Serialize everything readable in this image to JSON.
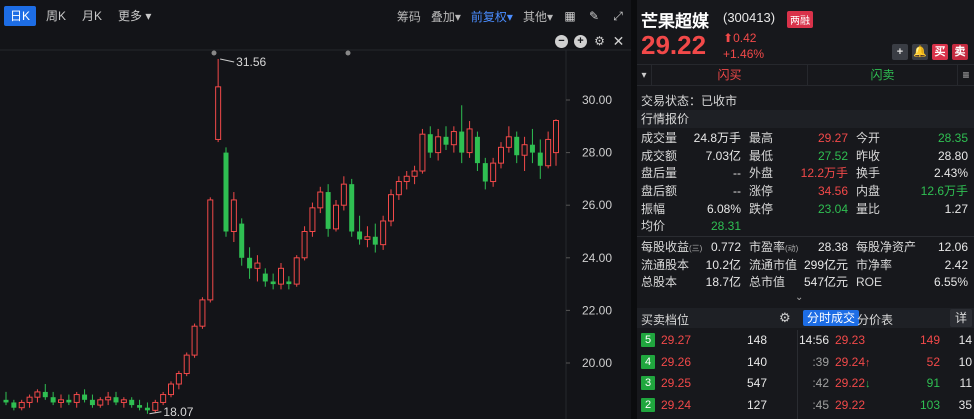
{
  "toolbar": {
    "tabs": [
      "日K",
      "周K",
      "月K",
      "更多"
    ],
    "right_items": [
      "筹码",
      "叠加",
      "前复权",
      "其他"
    ]
  },
  "chart_data": {
    "type": "candlestick",
    "y_ticks": [
      "30.00",
      "28.00",
      "26.00",
      "24.00",
      "22.00",
      "20.00"
    ],
    "ylim": [
      18.0,
      31.8
    ],
    "max_label": "31.56",
    "min_label": "18.07",
    "up_color": "#f24949",
    "down_color": "#2fbf52",
    "candles": [
      {
        "o": 18.6,
        "h": 18.9,
        "l": 18.4,
        "c": 18.5
      },
      {
        "o": 18.5,
        "h": 18.6,
        "l": 18.2,
        "c": 18.3
      },
      {
        "o": 18.3,
        "h": 18.6,
        "l": 18.2,
        "c": 18.5
      },
      {
        "o": 18.5,
        "h": 18.8,
        "l": 18.3,
        "c": 18.7
      },
      {
        "o": 18.7,
        "h": 19.0,
        "l": 18.5,
        "c": 18.9
      },
      {
        "o": 18.9,
        "h": 19.2,
        "l": 18.6,
        "c": 18.7
      },
      {
        "o": 18.7,
        "h": 18.9,
        "l": 18.4,
        "c": 18.5
      },
      {
        "o": 18.5,
        "h": 18.8,
        "l": 18.3,
        "c": 18.6
      },
      {
        "o": 18.6,
        "h": 18.8,
        "l": 18.4,
        "c": 18.5
      },
      {
        "o": 18.5,
        "h": 18.9,
        "l": 18.3,
        "c": 18.8
      },
      {
        "o": 18.8,
        "h": 19.0,
        "l": 18.5,
        "c": 18.6
      },
      {
        "o": 18.6,
        "h": 18.8,
        "l": 18.3,
        "c": 18.4
      },
      {
        "o": 18.4,
        "h": 18.7,
        "l": 18.3,
        "c": 18.6
      },
      {
        "o": 18.6,
        "h": 18.9,
        "l": 18.4,
        "c": 18.7
      },
      {
        "o": 18.7,
        "h": 18.9,
        "l": 18.4,
        "c": 18.5
      },
      {
        "o": 18.5,
        "h": 18.7,
        "l": 18.3,
        "c": 18.6
      },
      {
        "o": 18.6,
        "h": 18.7,
        "l": 18.3,
        "c": 18.4
      },
      {
        "o": 18.4,
        "h": 18.6,
        "l": 18.2,
        "c": 18.3
      },
      {
        "o": 18.3,
        "h": 18.5,
        "l": 18.07,
        "c": 18.2
      },
      {
        "o": 18.2,
        "h": 18.6,
        "l": 18.1,
        "c": 18.5
      },
      {
        "o": 18.5,
        "h": 18.9,
        "l": 18.4,
        "c": 18.8
      },
      {
        "o": 18.8,
        "h": 19.3,
        "l": 18.7,
        "c": 19.2
      },
      {
        "o": 19.2,
        "h": 19.7,
        "l": 19.0,
        "c": 19.6
      },
      {
        "o": 19.6,
        "h": 20.4,
        "l": 19.5,
        "c": 20.3
      },
      {
        "o": 20.3,
        "h": 21.5,
        "l": 20.2,
        "c": 21.4
      },
      {
        "o": 21.4,
        "h": 22.5,
        "l": 21.3,
        "c": 22.4
      },
      {
        "o": 22.4,
        "h": 26.3,
        "l": 22.3,
        "c": 26.2
      },
      {
        "o": 28.5,
        "h": 31.56,
        "l": 28.4,
        "c": 30.5
      },
      {
        "o": 28.0,
        "h": 28.2,
        "l": 24.8,
        "c": 25.0
      },
      {
        "o": 25.0,
        "h": 26.5,
        "l": 24.6,
        "c": 26.2
      },
      {
        "o": 25.3,
        "h": 25.5,
        "l": 23.7,
        "c": 24.0
      },
      {
        "o": 24.0,
        "h": 24.4,
        "l": 23.2,
        "c": 23.6
      },
      {
        "o": 23.6,
        "h": 24.1,
        "l": 23.1,
        "c": 23.8
      },
      {
        "o": 23.4,
        "h": 23.6,
        "l": 22.9,
        "c": 23.1
      },
      {
        "o": 23.1,
        "h": 23.4,
        "l": 22.8,
        "c": 23.0
      },
      {
        "o": 23.0,
        "h": 23.8,
        "l": 22.8,
        "c": 23.6
      },
      {
        "o": 23.1,
        "h": 23.3,
        "l": 22.8,
        "c": 23.0
      },
      {
        "o": 23.0,
        "h": 24.1,
        "l": 22.9,
        "c": 24.0
      },
      {
        "o": 24.0,
        "h": 25.2,
        "l": 23.9,
        "c": 25.0
      },
      {
        "o": 25.0,
        "h": 26.1,
        "l": 24.8,
        "c": 25.9
      },
      {
        "o": 25.9,
        "h": 26.7,
        "l": 25.7,
        "c": 26.5
      },
      {
        "o": 26.5,
        "h": 26.8,
        "l": 24.8,
        "c": 25.1
      },
      {
        "o": 25.1,
        "h": 26.2,
        "l": 25.0,
        "c": 26.0
      },
      {
        "o": 26.0,
        "h": 27.1,
        "l": 25.8,
        "c": 26.8
      },
      {
        "o": 26.8,
        "h": 27.0,
        "l": 24.8,
        "c": 25.0
      },
      {
        "o": 25.0,
        "h": 25.6,
        "l": 24.5,
        "c": 24.7
      },
      {
        "o": 24.7,
        "h": 25.2,
        "l": 24.4,
        "c": 24.8
      },
      {
        "o": 24.8,
        "h": 25.3,
        "l": 24.2,
        "c": 24.5
      },
      {
        "o": 24.5,
        "h": 25.6,
        "l": 24.3,
        "c": 25.4
      },
      {
        "o": 25.4,
        "h": 26.6,
        "l": 25.2,
        "c": 26.4
      },
      {
        "o": 26.4,
        "h": 27.1,
        "l": 26.2,
        "c": 26.9
      },
      {
        "o": 26.9,
        "h": 27.3,
        "l": 26.6,
        "c": 27.1
      },
      {
        "o": 27.1,
        "h": 27.5,
        "l": 26.8,
        "c": 27.3
      },
      {
        "o": 27.3,
        "h": 28.9,
        "l": 27.2,
        "c": 28.7
      },
      {
        "o": 28.7,
        "h": 29.0,
        "l": 27.8,
        "c": 28.0
      },
      {
        "o": 28.0,
        "h": 28.9,
        "l": 27.7,
        "c": 28.6
      },
      {
        "o": 28.6,
        "h": 29.0,
        "l": 28.1,
        "c": 28.3
      },
      {
        "o": 28.3,
        "h": 29.0,
        "l": 28.0,
        "c": 28.8
      },
      {
        "o": 28.8,
        "h": 29.8,
        "l": 27.6,
        "c": 28.0
      },
      {
        "o": 28.0,
        "h": 29.2,
        "l": 27.8,
        "c": 28.9
      },
      {
        "o": 28.6,
        "h": 28.8,
        "l": 27.3,
        "c": 27.6
      },
      {
        "o": 27.6,
        "h": 27.8,
        "l": 26.6,
        "c": 26.9
      },
      {
        "o": 26.9,
        "h": 27.8,
        "l": 26.7,
        "c": 27.6
      },
      {
        "o": 27.6,
        "h": 28.4,
        "l": 27.4,
        "c": 28.2
      },
      {
        "o": 28.2,
        "h": 29.0,
        "l": 28.0,
        "c": 28.6
      },
      {
        "o": 28.6,
        "h": 28.8,
        "l": 27.6,
        "c": 27.9
      },
      {
        "o": 27.9,
        "h": 28.6,
        "l": 27.3,
        "c": 28.3
      },
      {
        "o": 28.3,
        "h": 28.9,
        "l": 27.6,
        "c": 28.0
      },
      {
        "o": 28.0,
        "h": 28.5,
        "l": 27.0,
        "c": 27.5
      },
      {
        "o": 27.5,
        "h": 28.8,
        "l": 27.4,
        "c": 28.5
      },
      {
        "o": 28.0,
        "h": 29.27,
        "l": 27.5,
        "c": 29.22
      }
    ]
  },
  "stock": {
    "name": "芒果超媒",
    "code": "(300413)",
    "badge": "两融",
    "price": "29.22",
    "change": "0.42",
    "change_pct": "+1.46%"
  },
  "header_buttons": [
    "+",
    "●",
    "买",
    "卖"
  ],
  "trade": {
    "flash_buy": "闪买",
    "flash_sell": "闪卖",
    "sm": "▾",
    "menu": "≡"
  },
  "status_label": "交易状态：已收市",
  "quote_section_title": "行情报价",
  "quotes": [
    [
      [
        "成交量",
        "24.8万手",
        "white"
      ],
      [
        "最高",
        "29.27",
        "red"
      ],
      [
        "今开",
        "28.35",
        "green"
      ]
    ],
    [
      [
        "成交额",
        "7.03亿",
        "white"
      ],
      [
        "最低",
        "27.52",
        "green"
      ],
      [
        "昨收",
        "28.80",
        "white"
      ]
    ],
    [
      [
        "盘后量",
        "--",
        "white"
      ],
      [
        "外盘",
        "12.2万手",
        "red"
      ],
      [
        "换手",
        "2.43%",
        "white"
      ]
    ],
    [
      [
        "盘后额",
        "--",
        "white"
      ],
      [
        "涨停",
        "34.56",
        "red"
      ],
      [
        "内盘",
        "12.6万手",
        "green"
      ]
    ],
    [
      [
        "振幅",
        "6.08%",
        "white"
      ],
      [
        "跌停",
        "23.04",
        "green"
      ],
      [
        "量比",
        "1.27",
        "white"
      ]
    ],
    [
      [
        "均价",
        "28.31",
        "green"
      ],
      [
        "",
        "",
        " "
      ],
      [
        "",
        "",
        ""
      ]
    ]
  ],
  "fundamentals": [
    [
      [
        "每股收益",
        "(三)",
        "0.772"
      ],
      [
        "市盈率",
        "(动)",
        "28.38"
      ],
      [
        "每股净资产",
        "",
        "12.06"
      ]
    ],
    [
      [
        "流通股本",
        "",
        "10.2亿"
      ],
      [
        "流通市值",
        "",
        "299亿元"
      ],
      [
        "市净率",
        "",
        "2.42"
      ]
    ],
    [
      [
        "总股本",
        "",
        "18.7亿"
      ],
      [
        "总市值",
        "",
        "547亿元"
      ],
      [
        "ROE",
        "",
        "6.55%"
      ]
    ]
  ],
  "orderbook": {
    "title": "买卖档位",
    "tab_ticks": "分时成交",
    "tab_price": "分价表",
    "tab_detail": "详",
    "asks": [
      {
        "level": "5",
        "price": "29.27",
        "vol": "148"
      },
      {
        "level": "4",
        "price": "29.26",
        "vol": "140"
      },
      {
        "level": "3",
        "price": "29.25",
        "vol": "547"
      },
      {
        "level": "2",
        "price": "29.24",
        "vol": "127"
      }
    ],
    "ticks": [
      {
        "time": "14:56",
        "price": "29.23",
        "arrow": "",
        "vol": "149",
        "vcolor": "red",
        "n": "14"
      },
      {
        "time": ":39",
        "price": "29.24",
        "arrow": "↑",
        "vol": "52",
        "vcolor": "red",
        "n": "10"
      },
      {
        "time": ":42",
        "price": "29.22",
        "arrow": "↓",
        "vol": "91",
        "vcolor": "green",
        "n": "11"
      },
      {
        "time": ":45",
        "price": "29.22",
        "arrow": "",
        "vol": "103",
        "vcolor": "green",
        "n": "35"
      }
    ]
  }
}
